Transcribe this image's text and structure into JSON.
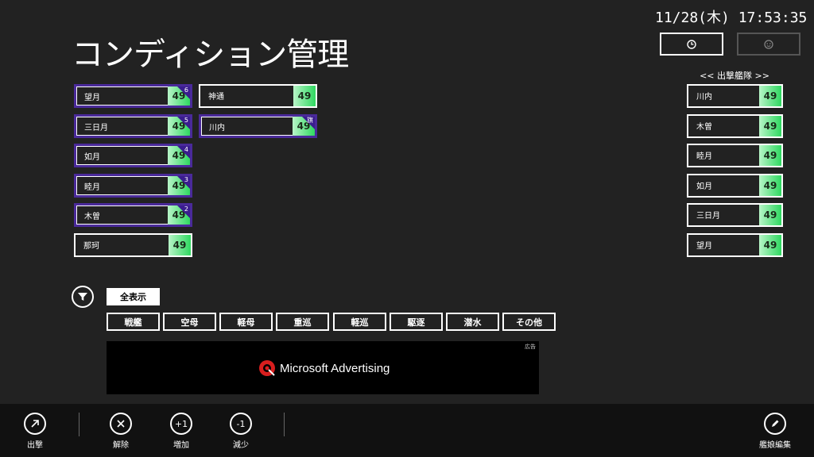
{
  "header": {
    "clock": "11/28(木) 17:53:35",
    "title": "コンディション管理"
  },
  "top_buttons": {
    "clock_icon": "clock-icon",
    "face_icon": "face-icon"
  },
  "ships": [
    {
      "name": "望月",
      "cond": "49",
      "badge": "6",
      "selected": true
    },
    {
      "name": "三日月",
      "cond": "49",
      "badge": "5",
      "selected": true
    },
    {
      "name": "如月",
      "cond": "49",
      "badge": "4",
      "selected": true
    },
    {
      "name": "睦月",
      "cond": "49",
      "badge": "3",
      "selected": true
    },
    {
      "name": "木曽",
      "cond": "49",
      "badge": "2",
      "selected": true
    },
    {
      "name": "那珂",
      "cond": "49",
      "badge": "",
      "selected": false
    },
    {
      "name": "神通",
      "cond": "49",
      "badge": "",
      "selected": false
    },
    {
      "name": "川内",
      "cond": "49",
      "badge": "旗",
      "selected": true
    }
  ],
  "fleet": {
    "header": "<< 出撃艦隊 >>",
    "ships": [
      {
        "name": "川内",
        "cond": "49"
      },
      {
        "name": "木曽",
        "cond": "49"
      },
      {
        "name": "睦月",
        "cond": "49"
      },
      {
        "name": "如月",
        "cond": "49"
      },
      {
        "name": "三日月",
        "cond": "49"
      },
      {
        "name": "望月",
        "cond": "49"
      }
    ]
  },
  "filter": {
    "show_all": "全表示",
    "types": [
      "戦艦",
      "空母",
      "軽母",
      "重巡",
      "軽巡",
      "駆逐",
      "潜水",
      "その他"
    ]
  },
  "ad": {
    "label": "広告",
    "text": "Microsoft Advertising"
  },
  "appbar": {
    "sortie": "出撃",
    "release": "解除",
    "increase": "増加",
    "increase_icon_text": "+1",
    "decrease": "減少",
    "decrease_icon_text": "-1",
    "edit": "艦娘編集"
  },
  "colors": {
    "background": "#222222",
    "selected_border": "#4a2a9a",
    "cond_green": "#2fd860"
  }
}
